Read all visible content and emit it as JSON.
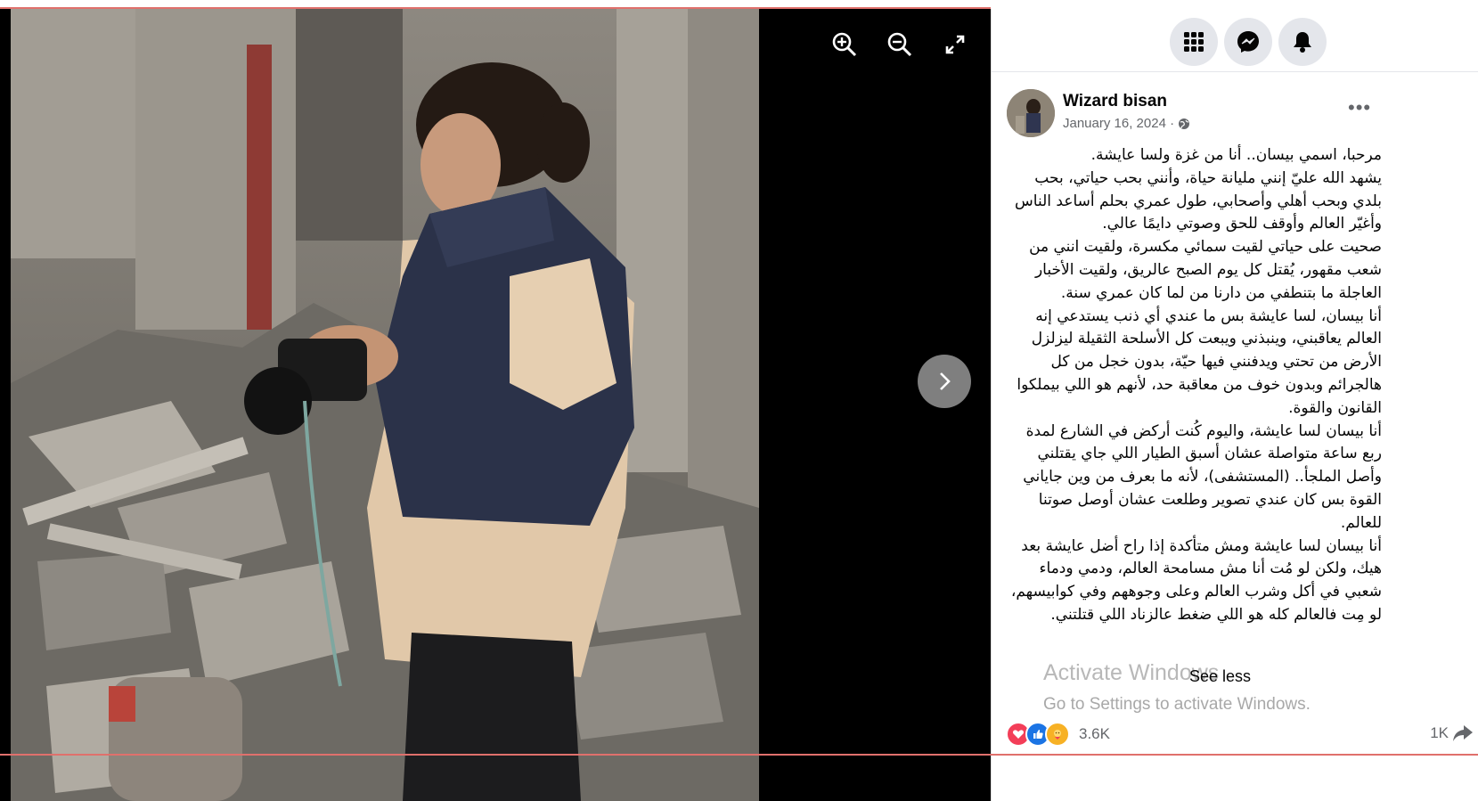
{
  "viewer": {
    "zoom_in_icon": "zoom-in-icon",
    "zoom_out_icon": "zoom-out-icon",
    "fullscreen_icon": "fullscreen-icon",
    "next_icon": "chevron-right-icon"
  },
  "topbar": {
    "menu_icon": "grid-menu-icon",
    "messenger_icon": "messenger-icon",
    "notifications_icon": "bell-icon"
  },
  "post": {
    "author": "Wizard bisan",
    "date": "January 16, 2024 ·",
    "privacy_icon": "globe-icon",
    "more_label": "•••",
    "paragraphs": [
      "مرحبا، اسمي بيسان.. أنا من غزة ولسا عايشة.",
      "يشهد الله عليّ إنني مليانة حياة، وأنني بحب حياتي، بحب بلدي وبحب أهلي وأصحابي، طول عمري بحلم أساعد الناس وأغيّر العالم وأوقف للحق وصوتي دايمًا عالي.",
      "صحيت على حياتي لقيت سمائي مكسرة، ولقيت انني من شعب مقهور، يُقتل كل يوم الصبح عالريق، ولقيت الأخبار العاجلة ما بتنطفي من دارنا من لما كان عمري سنة.",
      "أنا بيسان، لسا عايشة بس ما عندي أي ذنب يستدعي إنه العالم يعاقبني، وينبذني ويبعت كل الأسلحة الثقيلة ليزلزل الأرض من تحتي ويدفنني فيها حيّة، بدون خجل من كل هالجرائم وبدون خوف من معاقبة حد، لأنهم هو اللي بيملكوا القانون والقوة.",
      "أنا بيسان لسا عايشة، واليوم كُنت أركض في الشارع لمدة ربع ساعة متواصلة عشان أسبق الطيار اللي جاي يقتلني وأصل الملجأ.. (المستشفى)، لأنه ما بعرف من وين جاياني القوة بس كان عندي تصوير وطلعت عشان أوصل صوتنا للعالم.",
      "أنا بيسان لسا عايشة ومش متأكدة إذا راح أضل عايشة بعد هيك، ولكن لو مُت أنا مش مسامحة العالم، ودمي ودماء شعبي في أكل وشرب العالم وعلى وجوههم وفي كوابيسهم، لو مِت فالعالم كله هو اللي ضغط عالزناد اللي قتلتني."
    ],
    "see_less": "See less",
    "reactions_count": "3.6K",
    "shares_count": "1K",
    "reaction_icons": [
      "heart-icon",
      "like-icon",
      "care-icon"
    ],
    "share_icon": "share-icon"
  },
  "watermark": {
    "line1": "Activate Windows",
    "line2": "Go to Settings to activate Windows."
  },
  "colors": {
    "fb_blue": "#1877f2",
    "like_blue": "#1b74e4",
    "love_red": "#f33e58",
    "care_yellow": "#f7b125",
    "button_gray": "#e4e6eb",
    "text_secondary": "#65676b"
  }
}
